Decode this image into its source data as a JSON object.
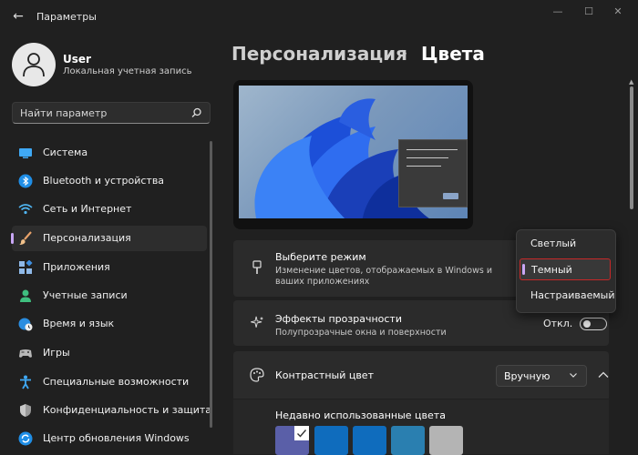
{
  "app": {
    "title": "Параметры"
  },
  "user": {
    "name": "User",
    "subtitle": "Локальная учетная запись"
  },
  "search": {
    "placeholder": "Найти параметр"
  },
  "nav": [
    {
      "label": "Система",
      "icon": "monitor-icon"
    },
    {
      "label": "Bluetooth и устройства",
      "icon": "bluetooth-icon"
    },
    {
      "label": "Сеть и Интернет",
      "icon": "wifi-icon"
    },
    {
      "label": "Персонализация",
      "icon": "brush-icon",
      "active": true
    },
    {
      "label": "Приложения",
      "icon": "apps-icon"
    },
    {
      "label": "Учетные записи",
      "icon": "person-icon"
    },
    {
      "label": "Время и язык",
      "icon": "globe-clock-icon"
    },
    {
      "label": "Игры",
      "icon": "gamepad-icon"
    },
    {
      "label": "Специальные возможности",
      "icon": "accessibility-icon"
    },
    {
      "label": "Конфиденциальность и защита",
      "icon": "shield-icon"
    },
    {
      "label": "Центр обновления Windows",
      "icon": "update-icon"
    }
  ],
  "breadcrumb": {
    "parent": "Персонализация",
    "separator": "›",
    "current": "Цвета"
  },
  "mode": {
    "title": "Выберите режим",
    "subtitle": "Изменение цветов, отображаемых в Windows и ваших приложениях",
    "options": [
      "Светлый",
      "Темный",
      "Настраиваемый"
    ],
    "selected": "Темный"
  },
  "transparency": {
    "title": "Эффекты прозрачности",
    "subtitle": "Полупрозрачные окна и поверхности",
    "state_label": "Откл.",
    "on": false
  },
  "accent": {
    "title": "Контрастный цвет",
    "value": "Вручную",
    "recent_label": "Недавно использованные цвета",
    "recent_colors": [
      "#5a5fa8",
      "#0f6cbd",
      "#0f6cbd",
      "#2a7fb0",
      "#b4b4b4"
    ]
  },
  "colors": {
    "accent": "#c9a7f5",
    "background": "#202020",
    "card": "#2b2b2b"
  }
}
